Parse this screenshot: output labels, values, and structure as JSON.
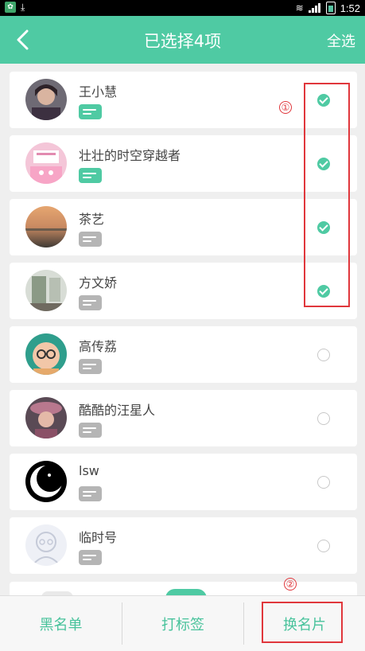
{
  "status_bar": {
    "time": "1:52",
    "icons": [
      "app-icon",
      "download-icon",
      "wifi-icon",
      "signal-icon",
      "battery-icon"
    ]
  },
  "header": {
    "title": "已选择4项",
    "select_all": "全选",
    "back_icon": "back-arrow-icon"
  },
  "contacts": [
    {
      "name": "王小慧",
      "selected": true,
      "card_color": "green"
    },
    {
      "name": "壮壮的时空穿越者",
      "selected": true,
      "card_color": "green"
    },
    {
      "name": "茶艺",
      "selected": true,
      "card_color": "gray"
    },
    {
      "name": "方文娇",
      "selected": true,
      "card_color": "gray"
    },
    {
      "name": "高传荔",
      "selected": false,
      "card_color": "gray"
    },
    {
      "name": "酷酷的汪星人",
      "selected": false,
      "card_color": "gray"
    },
    {
      "name": "lsw",
      "selected": false,
      "card_color": "gray"
    },
    {
      "name": "临时号",
      "selected": false,
      "card_color": "gray"
    }
  ],
  "annotations": {
    "one": "①",
    "two": "②"
  },
  "bottom_bar": {
    "blacklist": "黑名单",
    "tag": "打标签",
    "swap_card": "换名片"
  },
  "colors": {
    "accent": "#4fcaa3",
    "annotation": "#e0373c",
    "badge_gray": "#b5b5b5"
  }
}
